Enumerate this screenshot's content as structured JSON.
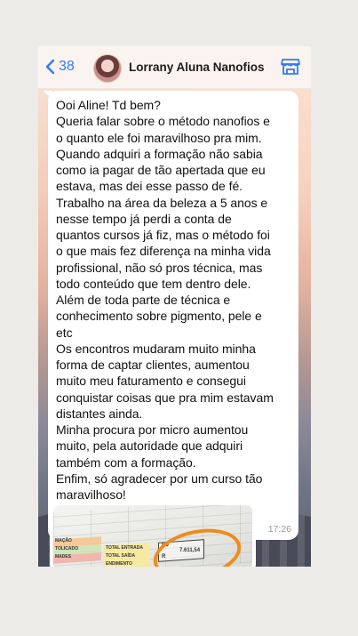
{
  "header": {
    "back_count": "38",
    "contact_name": "Lorrany Aluna Nanofios",
    "store_icon": "storefront-icon",
    "back_icon": "chevron-left-icon",
    "accent_color": "#2f7bf6"
  },
  "message": {
    "text": "Ooi Aline! Td bem?\nQueria falar sobre o método nanofios e\no quanto ele foi maravilhoso pra mim.\nQuando  adquiri a formação não sabia\ncomo ia pagar de tão apertada que eu\nestava, mas dei esse passo de fé.\nTrabalho na área da beleza a 5 anos e\nnesse tempo já perdi a conta de\nquantos cursos já fiz, mas o método foi\no que mais fez diferença na minha vida\nprofissional, não só pros técnica, mas\ntodo conteúdo que tem dentro dele.\nAlém de toda parte de técnica e\nconhecimento sobre pigmento, pele e\netc\nOs encontros mudaram muito minha\nforma de captar clientes, aumentou\nmuito meu faturamento e consegui\nconquistar coisas que pra mim estavam\ndistantes ainda.\nMinha procura por micro aumentou\nmuito, pela autoridade que adquiri\ntambém com a formação.\nEnfim, só agradecer por um curso tão\nmaravilhoso!",
    "time": "17:26"
  },
  "image_message": {
    "labels": {
      "row1": "MAÇÃO",
      "row2": "TOLICADO",
      "row3": "MADES",
      "total_entrada": "TOTAL ENTRADA",
      "total_saida": "TOTAL SAÍDA",
      "rendimento": "ENDIMENTO",
      "currency": "R$",
      "value": "7.611,54",
      "currency2": "R"
    },
    "highlight_color": "#f08a1c"
  }
}
